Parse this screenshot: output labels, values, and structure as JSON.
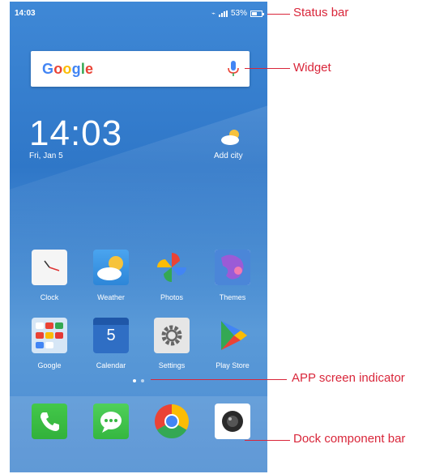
{
  "status_bar": {
    "time": "14:03",
    "battery": "53%",
    "battery_level": 0.53
  },
  "widget": {
    "logo": [
      "G",
      "o",
      "o",
      "g",
      "l",
      "e"
    ]
  },
  "clock_widget": {
    "time": "14:03",
    "date": "Fri, Jan 5",
    "weather_action": "Add city"
  },
  "apps_row1": [
    {
      "label": "Clock",
      "icon": "clock-icon"
    },
    {
      "label": "Weather",
      "icon": "weather-icon"
    },
    {
      "label": "Photos",
      "icon": "photos-icon"
    },
    {
      "label": "Themes",
      "icon": "themes-icon"
    }
  ],
  "apps_row2": [
    {
      "label": "Google",
      "icon": "google-folder-icon"
    },
    {
      "label": "Calendar",
      "icon": "calendar-icon",
      "day": "5"
    },
    {
      "label": "Settings",
      "icon": "settings-icon"
    },
    {
      "label": "Play Store",
      "icon": "play-store-icon"
    }
  ],
  "page_indicator": {
    "pages": 2,
    "current": 1
  },
  "dock": [
    {
      "icon": "phone-icon"
    },
    {
      "icon": "messages-icon"
    },
    {
      "icon": "chrome-icon"
    },
    {
      "icon": "camera-icon"
    }
  ],
  "annotations": {
    "status_bar": "Status bar",
    "widget": "Widget",
    "app_screen_indicator": "APP screen indicator",
    "dock_bar": "Dock component bar"
  },
  "colors": {
    "annotation": "#d9263a",
    "wallpaper": "#3f88d6"
  }
}
